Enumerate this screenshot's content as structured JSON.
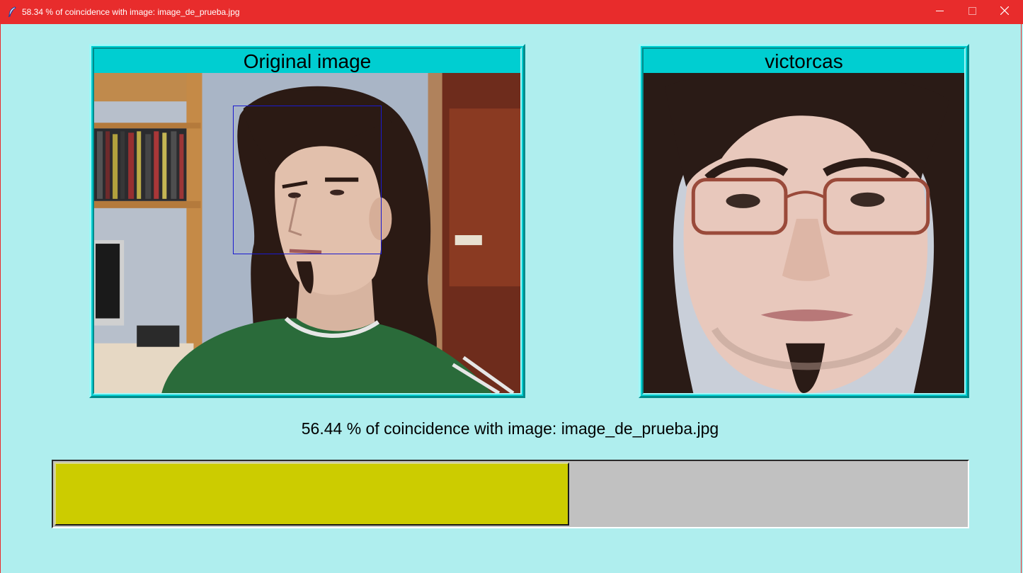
{
  "window": {
    "title": "58.34 % of coincidence with image: image_de_prueba.jpg",
    "icon": "feather-icon",
    "controls": [
      "minimize-icon",
      "maximize-icon",
      "close-icon"
    ],
    "title_bar_color": "#e82c2c"
  },
  "left_panel": {
    "title": "Original image",
    "image": "webcam photo of a young man with long dark hair in a green shirt, room with bookshelf behind",
    "face_detection_box": true
  },
  "right_panel": {
    "title": "victorcas",
    "image": "close-up face photo of a young man with glasses and goatee"
  },
  "status": {
    "text": "56.44 % of coincidence with image: image_de_prueba.jpg"
  },
  "progress": {
    "value_percent": 56.44,
    "fill_color": "#cccc00",
    "track_color": "#c1c1c1"
  },
  "colors": {
    "background": "#afeeee",
    "frame": "#00ced1"
  }
}
